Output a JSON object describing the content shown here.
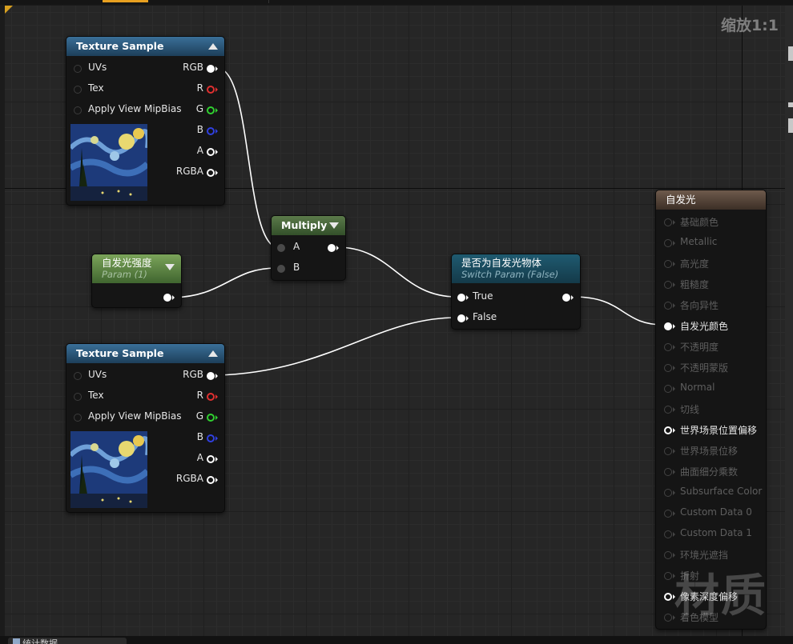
{
  "zoom_label": "缩放1:1",
  "watermark": "材质",
  "bottom_tab_label": "统计数据",
  "nodes": {
    "texture_sample_1": {
      "title": "Texture Sample",
      "inputs": [
        "UVs",
        "Tex",
        "Apply View MipBias"
      ],
      "outputs": [
        "RGB",
        "R",
        "G",
        "B",
        "A",
        "RGBA"
      ]
    },
    "texture_sample_2": {
      "title": "Texture Sample",
      "inputs": [
        "UVs",
        "Tex",
        "Apply View MipBias"
      ],
      "outputs": [
        "RGB",
        "R",
        "G",
        "B",
        "A",
        "RGBA"
      ]
    },
    "multiply": {
      "title": "Multiply",
      "inputs": [
        "A",
        "B"
      ]
    },
    "emissive_intensity": {
      "title": "自发光强度",
      "subtitle": "Param (1)"
    },
    "switch": {
      "title": "是否为自发光物体",
      "subtitle": "Switch Param (False)",
      "inputs": [
        "True",
        "False"
      ]
    },
    "material": {
      "title": "自发光",
      "pins": [
        "基础颜色",
        "Metallic",
        "高光度",
        "粗糙度",
        "各向异性",
        "自发光颜色",
        "不透明度",
        "不透明蒙版",
        "Normal",
        "切线",
        "世界场景位置偏移",
        "世界场景位移",
        "曲面细分乘数",
        "Subsurface Color",
        "Custom Data 0",
        "Custom Data 1",
        "环境光遮挡",
        "折射",
        "像素深度偏移",
        "着色模型"
      ]
    }
  },
  "colors": {
    "graph_bg": "#262626",
    "texture_header": "#2e5f86",
    "multiply_header": "#4e6e3e",
    "param_header": "#6a9a48",
    "switch_header": "#1f5a70",
    "material_header": "#6e5a4c",
    "pin_r": "#e03030",
    "pin_g": "#30d030",
    "pin_b": "#3040e0",
    "wire": "#ffffff"
  },
  "icons": {
    "collapse": "triangle-up-icon",
    "expand": "triangle-down-icon",
    "connected_pin": "filled-circle-icon",
    "disconnected_pin": "hollow-circle-icon"
  }
}
